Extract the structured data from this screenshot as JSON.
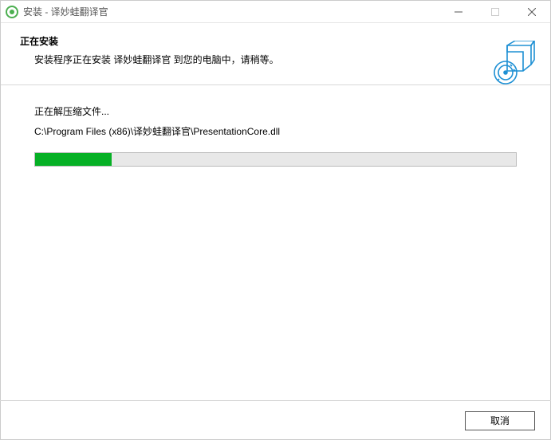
{
  "titlebar": {
    "title": "安装 - 译妙蛙翻译官"
  },
  "header": {
    "title": "正在安装",
    "subtitle": "安装程序正在安装 译妙蛙翻译官 到您的电脑中，请稍等。"
  },
  "content": {
    "extract_label": "正在解压缩文件...",
    "file_path": "C:\\Program Files (x86)\\译妙蛙翻译官\\PresentationCore.dll",
    "progress_percent": 16
  },
  "footer": {
    "cancel_label": "取消"
  },
  "colors": {
    "progress_fill": "#06B025",
    "accent": "#1E90D4"
  }
}
